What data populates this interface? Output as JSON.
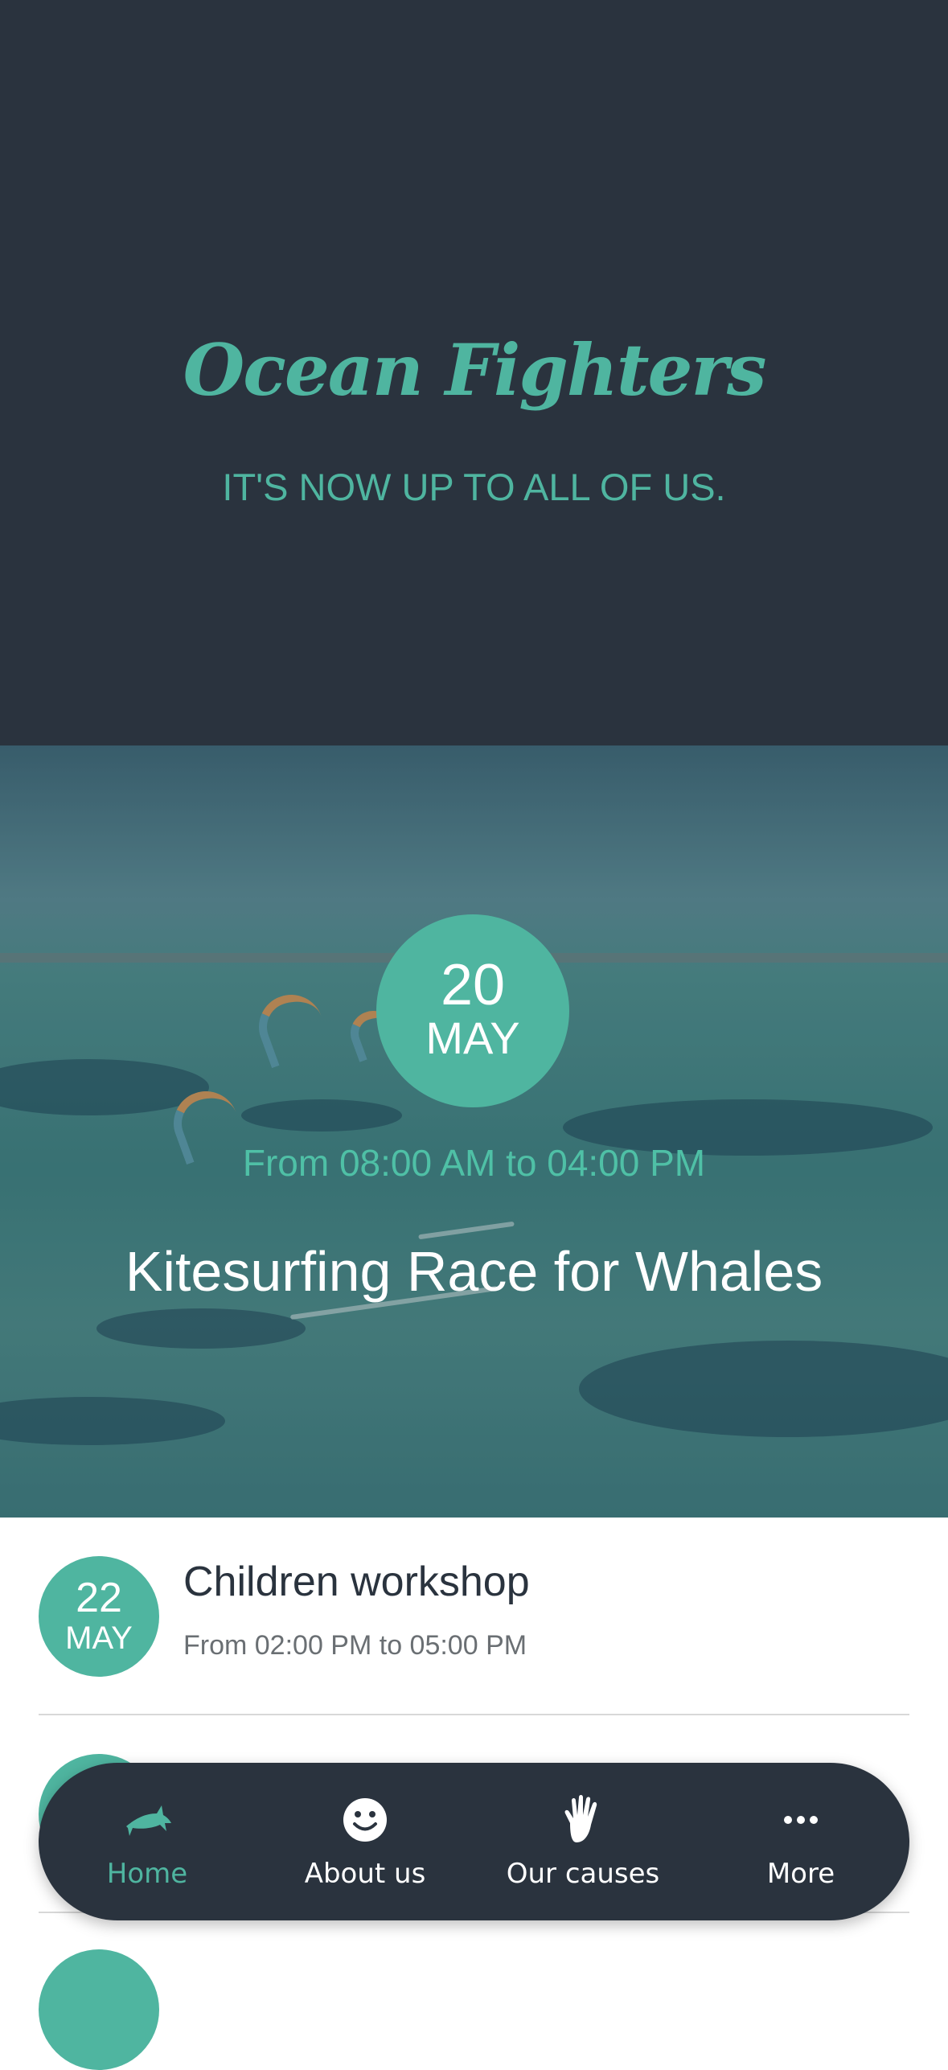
{
  "header": {
    "brand": "Ocean Fighters",
    "tagline": "IT'S NOW UP TO ALL OF US."
  },
  "featured_event": {
    "day": "20",
    "month": "MAY",
    "time": "From 08:00 AM to 04:00 PM",
    "title": "Kitesurfing Race for Whales"
  },
  "events": [
    {
      "day": "22",
      "month": "MAY",
      "title": "Children workshop",
      "time": "From 02:00 PM to 05:00 PM"
    },
    {
      "day": "",
      "month": "",
      "title": "",
      "time": ""
    }
  ],
  "nav": {
    "items": [
      {
        "label": "Home",
        "icon": "shark-icon",
        "active": true
      },
      {
        "label": "About us",
        "icon": "smiley-icon",
        "active": false
      },
      {
        "label": "Our causes",
        "icon": "hand-icon",
        "active": false
      },
      {
        "label": "More",
        "icon": "more-dots-icon",
        "active": false
      }
    ]
  },
  "colors": {
    "accent": "#4fb5a0",
    "dark": "#2a333e",
    "white": "#ffffff"
  }
}
